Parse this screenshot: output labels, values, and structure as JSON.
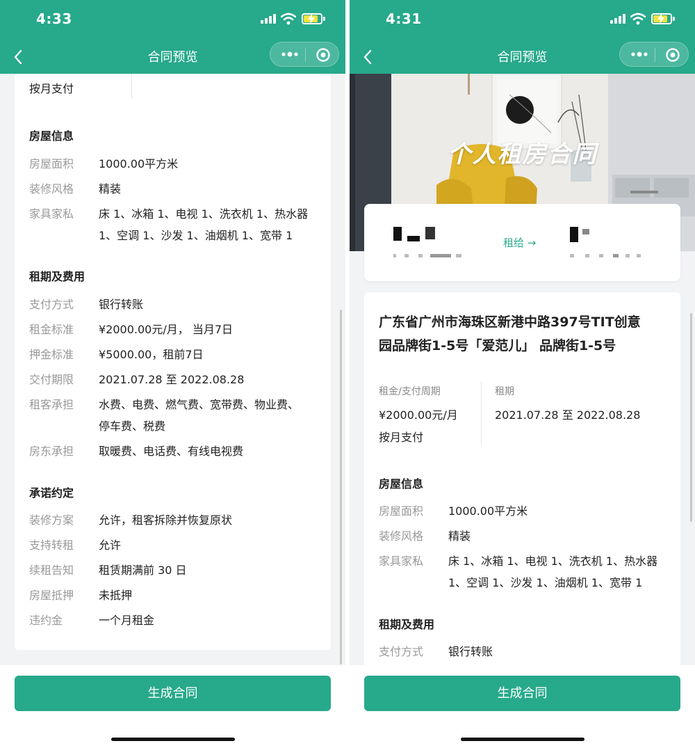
{
  "left": {
    "status": {
      "time": "4:33"
    },
    "nav": {
      "title": "合同预览"
    },
    "top_row": {
      "label": "按月支付"
    },
    "house_info": {
      "heading": "房屋信息",
      "rows": [
        {
          "k": "房屋面积",
          "v": "1000.00平方米"
        },
        {
          "k": "装修风格",
          "v": "精装"
        },
        {
          "k": "家具家私",
          "v1": "床 1、冰箱 1、电视 1、洗衣机 1、热水器",
          "v2": "1、空调 1、沙发 1、油烟机 1、宽带 1"
        }
      ]
    },
    "lease": {
      "heading": "租期及费用",
      "rows": [
        {
          "k": "支付方式",
          "v": "银行转账"
        },
        {
          "k": "租金标准",
          "v": "¥2000.00元/月， 当月7日"
        },
        {
          "k": "押金标准",
          "v": "¥5000.00，租前7日"
        },
        {
          "k": "交付期限",
          "v": "2021.07.28 至 2022.08.28"
        },
        {
          "k": "租客承担",
          "v1": "水费、电费、燃气费、宽带费、物业费、",
          "v2": "停车费、税费"
        },
        {
          "k": "房东承担",
          "v": "取暖费、电话费、有线电视费"
        }
      ]
    },
    "promise": {
      "heading": "承诺约定",
      "rows": [
        {
          "k": "装修方案",
          "v": "允许，租客拆除并恢复原状"
        },
        {
          "k": "支持转租",
          "v": "允许"
        },
        {
          "k": "续租告知",
          "v": "租赁期满前 30 日"
        },
        {
          "k": "房屋抵押",
          "v": "未抵押"
        },
        {
          "k": "违约金",
          "v": "一个月租金"
        }
      ]
    },
    "button": "生成合同"
  },
  "right": {
    "status": {
      "time": "4:31"
    },
    "nav": {
      "title": "合同预览"
    },
    "hero_title": "个人租房合同",
    "rent_to": "租给 →",
    "address_line1": "广东省广州市海珠区新港中路397号TIT创意",
    "address_line2": "园品牌街1-5号「爱范儿」 品牌街1-5号",
    "rent_period": {
      "label": "租金/支付周期",
      "value": "¥2000.00元/月",
      "value2": "按月支付"
    },
    "term": {
      "label": "租期",
      "value": "2021.07.28 至 2022.08.28"
    },
    "house_info": {
      "heading": "房屋信息",
      "rows": [
        {
          "k": "房屋面积",
          "v": "1000.00平方米"
        },
        {
          "k": "装修风格",
          "v": "精装"
        },
        {
          "k": "家具家私",
          "v1": "床 1、冰箱 1、电视 1、洗衣机 1、热水器",
          "v2": "1、空调 1、沙发 1、油烟机 1、宽带 1"
        }
      ]
    },
    "lease": {
      "heading": "租期及费用",
      "rows": [
        {
          "k": "支付方式",
          "v": "银行转账"
        }
      ]
    },
    "button": "生成合同"
  },
  "colors": {
    "brand": "#27a98b",
    "battery": "#f3e33f"
  }
}
